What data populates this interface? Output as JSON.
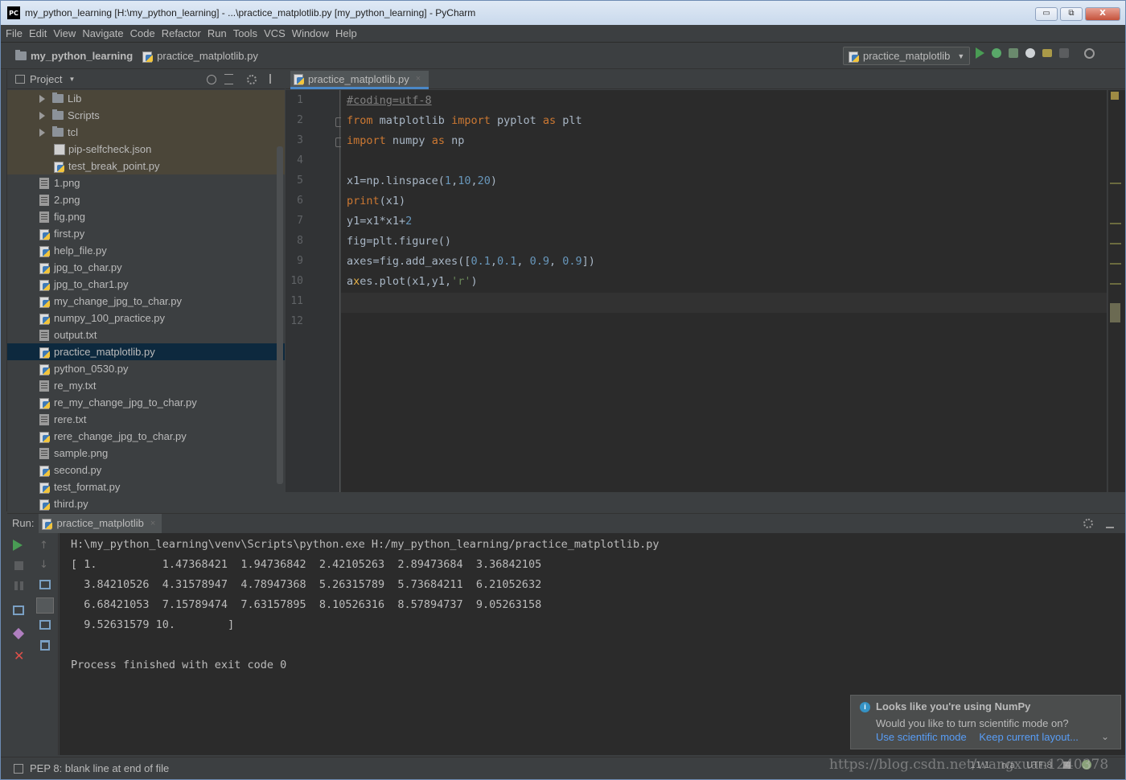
{
  "window": {
    "title": "my_python_learning [H:\\my_python_learning] - ...\\practice_matplotlib.py [my_python_learning] - PyCharm",
    "app_icon_text": "PC",
    "minimize": "▭",
    "maximize": "⧉",
    "close": "X"
  },
  "menu": [
    "File",
    "Edit",
    "View",
    "Navigate",
    "Code",
    "Refactor",
    "Run",
    "Tools",
    "VCS",
    "Window",
    "Help"
  ],
  "breadcrumb": {
    "project": "my_python_learning",
    "file": "practice_matplotlib.py"
  },
  "run_config": {
    "label": "practice_matplotlib",
    "dropdown_arrow": "▼"
  },
  "project_panel": {
    "title": "Project",
    "title_arrow": "▼",
    "items": [
      {
        "label": "Lib",
        "type": "folder",
        "excluded": true,
        "indent": 1
      },
      {
        "label": "Scripts",
        "type": "folder",
        "excluded": true,
        "indent": 1
      },
      {
        "label": "tcl",
        "type": "folder",
        "excluded": true,
        "indent": 1
      },
      {
        "label": "pip-selfcheck.json",
        "type": "json",
        "excluded": true,
        "indent": 2
      },
      {
        "label": "test_break_point.py",
        "type": "py",
        "excluded": true,
        "indent": 2
      },
      {
        "label": "1.png",
        "type": "file",
        "indent": 0
      },
      {
        "label": "2.png",
        "type": "file",
        "indent": 0
      },
      {
        "label": "fig.png",
        "type": "file",
        "indent": 0
      },
      {
        "label": "first.py",
        "type": "py",
        "indent": 0
      },
      {
        "label": "help_file.py",
        "type": "py",
        "indent": 0
      },
      {
        "label": "jpg_to_char.py",
        "type": "py",
        "indent": 0
      },
      {
        "label": "jpg_to_char1.py",
        "type": "py",
        "indent": 0
      },
      {
        "label": "my_change_jpg_to_char.py",
        "type": "py",
        "indent": 0
      },
      {
        "label": "numpy_100_practice.py",
        "type": "py",
        "indent": 0
      },
      {
        "label": "output.txt",
        "type": "file",
        "indent": 0
      },
      {
        "label": "practice_matplotlib.py",
        "type": "py",
        "selected": true,
        "indent": 0
      },
      {
        "label": "python_0530.py",
        "type": "py",
        "indent": 0
      },
      {
        "label": "re_my.txt",
        "type": "file",
        "indent": 0
      },
      {
        "label": "re_my_change_jpg_to_char.py",
        "type": "py",
        "indent": 0
      },
      {
        "label": "rere.txt",
        "type": "file",
        "indent": 0
      },
      {
        "label": "rere_change_jpg_to_char.py",
        "type": "py",
        "indent": 0
      },
      {
        "label": "sample.png",
        "type": "file",
        "indent": 0
      },
      {
        "label": "second.py",
        "type": "py",
        "indent": 0
      },
      {
        "label": "test_format.py",
        "type": "py",
        "indent": 0
      },
      {
        "label": "third.py",
        "type": "py",
        "indent": 0
      }
    ]
  },
  "editor": {
    "tab_label": "practice_matplotlib.py",
    "tab_close": "×",
    "line_numbers": [
      "1",
      "2",
      "3",
      "4",
      "5",
      "6",
      "7",
      "8",
      "9",
      "10",
      "11",
      "12"
    ],
    "lines": [
      "#coding=utf-8",
      "from matplotlib import pyplot as plt",
      "import numpy as np",
      "",
      "x1=np.linspace(1,10,20)",
      "print(x1)",
      "y1=x1*x1+2",
      "fig=plt.figure()",
      "axes=fig.add_axes([0.1,0.1, 0.9, 0.9])",
      "axes.plot(x1,y1,'r')",
      "",
      ""
    ]
  },
  "run_panel": {
    "label": "Run:",
    "tab_label": "practice_matplotlib",
    "tab_close": "×",
    "console_lines": [
      "H:\\my_python_learning\\venv\\Scripts\\python.exe H:/my_python_learning/practice_matplotlib.py",
      "[ 1.          1.47368421  1.94736842  2.42105263  2.89473684  3.36842105",
      "  3.84210526  4.31578947  4.78947368  5.26315789  5.73684211  6.21052632",
      "  6.68421053  7.15789474  7.63157895  8.10526316  8.57894737  9.05263158",
      "  9.52631579 10.        ]",
      "",
      "Process finished with exit code 0"
    ]
  },
  "notification": {
    "icon": "i",
    "title": "Looks like you're using NumPy",
    "text": "Would you like to turn scientific mode on?",
    "link_use": "Use scientific mode",
    "link_keep": "Keep current layout...",
    "chevron": "⌄"
  },
  "status_bar": {
    "message": "PEP 8: blank line at end of file",
    "position": "11:1",
    "line_sep": "n/a",
    "encoding": "UTF-8",
    "watermark": "https://blog.csdn.net/wangxuan1240378"
  },
  "colors": {
    "background": "#3c3f41",
    "editor_bg": "#2b2b2b",
    "keyword": "#cc7832",
    "number": "#6897bb",
    "string": "#6a8759",
    "link": "#589df6",
    "selection": "#0d293e"
  }
}
